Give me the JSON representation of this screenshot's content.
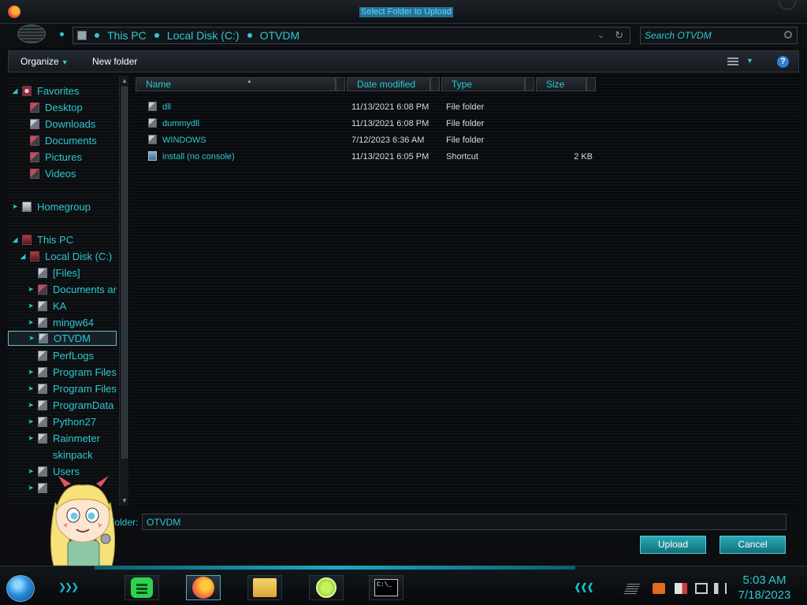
{
  "window": {
    "title": "Select Folder to Upload"
  },
  "address": {
    "breadcrumbs": [
      "This PC",
      "Local Disk (C:)",
      "OTVDM"
    ],
    "search_placeholder": "Search OTVDM"
  },
  "toolbar": {
    "organize_label": "Organize",
    "new_folder_label": "New folder"
  },
  "sidebar": {
    "favorites_label": "Favorites",
    "favorites": [
      "Desktop",
      "Downloads",
      "Documents",
      "Pictures",
      "Videos"
    ],
    "homegroup_label": "Homegroup",
    "this_pc_label": "This PC",
    "drive_label": "Local Disk (C:)",
    "folders": [
      "[Files]",
      "Documents ar",
      "KA",
      "mingw64",
      "OTVDM",
      "PerfLogs",
      "Program Files",
      "Program Files",
      "ProgramData",
      "Python27",
      "Rainmeter",
      "skinpack",
      "Users"
    ],
    "selected": "OTVDM"
  },
  "columns": {
    "name": "Name",
    "date": "Date modified",
    "type": "Type",
    "size": "Size"
  },
  "files": [
    {
      "name": "dll",
      "date": "11/13/2021 6:08 PM",
      "type": "File folder",
      "size": "",
      "icon": "folder-icon"
    },
    {
      "name": "dummydll",
      "date": "11/13/2021 6:08 PM",
      "type": "File folder",
      "size": "",
      "icon": "folder-icon"
    },
    {
      "name": "WINDOWS",
      "date": "7/12/2023 6:36 AM",
      "type": "File folder",
      "size": "",
      "icon": "folder-icon"
    },
    {
      "name": "install (no console)",
      "date": "11/13/2021 6:05 PM",
      "type": "Shortcut",
      "size": "2 KB",
      "icon": "shortcut-icon"
    }
  ],
  "footer": {
    "folder_label": "Folder:",
    "folder_value": "OTVDM",
    "upload_label": "Upload",
    "cancel_label": "Cancel"
  },
  "taskbar": {
    "apps": [
      "spotify-icon",
      "firefox-icon",
      "file-explorer-icon",
      "lime-app-icon",
      "command-prompt-icon"
    ],
    "cmd_glyph": "C:\\_",
    "time": "5:03 AM",
    "date": "7/18/2023"
  },
  "theme": {
    "accent": "#2ec8d2",
    "background": "#0b0d10",
    "button": "#1e97a3"
  }
}
